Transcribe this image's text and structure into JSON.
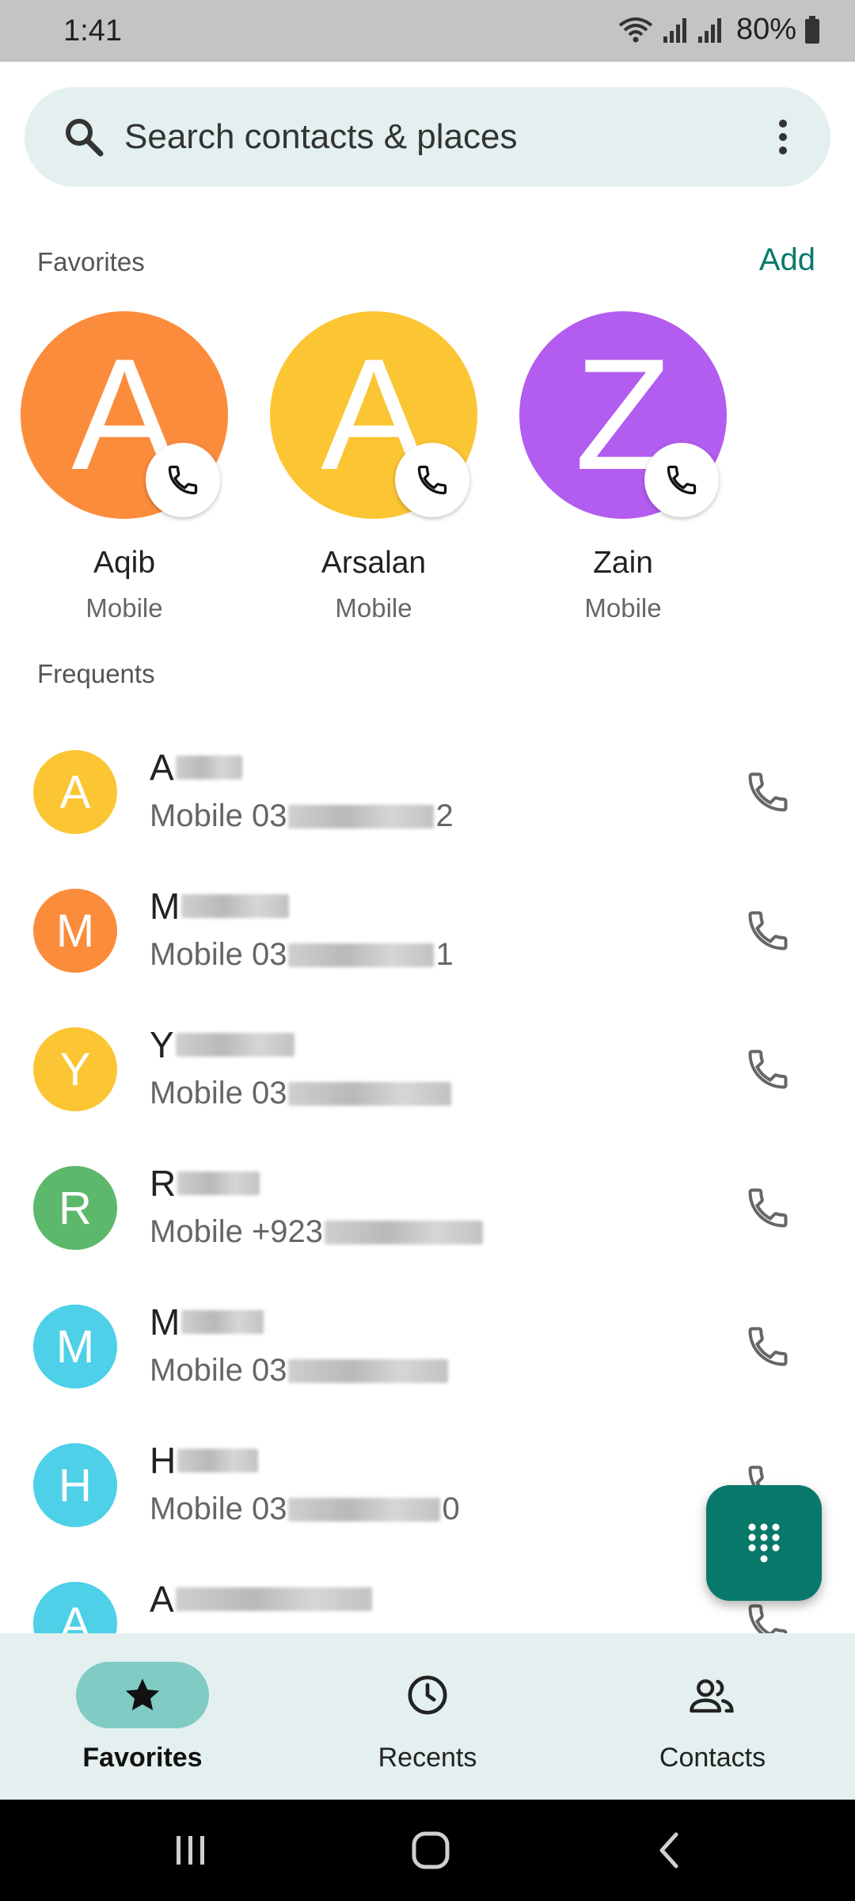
{
  "status_bar": {
    "time": "1:41",
    "battery": "80%"
  },
  "search": {
    "placeholder": "Search contacts & places"
  },
  "favorites": {
    "title": "Favorites",
    "add_label": "Add",
    "items": [
      {
        "initial": "A",
        "name": "Aqib",
        "type": "Mobile",
        "color": "#fb8c3c"
      },
      {
        "initial": "A",
        "name": "Arsalan",
        "type": "Mobile",
        "color": "#fbc534"
      },
      {
        "initial": "Z",
        "name": "Zain",
        "type": "Mobile",
        "color": "#b35cf0"
      }
    ]
  },
  "frequents": {
    "title": "Frequents",
    "items": [
      {
        "initial": "A",
        "color": "#fbc534",
        "name_visible": "A",
        "detail_prefix": "Mobile 03",
        "detail_suffix": "2"
      },
      {
        "initial": "M",
        "color": "#fb8c3c",
        "name_visible": "M",
        "detail_prefix": "Mobile 03",
        "detail_suffix": "1"
      },
      {
        "initial": "Y",
        "color": "#fbc534",
        "name_visible": "Y",
        "detail_prefix": "Mobile 03",
        "detail_suffix": ""
      },
      {
        "initial": "R",
        "color": "#5cb86a",
        "name_visible": "R",
        "detail_prefix": "Mobile +923",
        "detail_suffix": ""
      },
      {
        "initial": "M",
        "color": "#4dd0e8",
        "name_visible": "M",
        "detail_prefix": "Mobile 03",
        "detail_suffix": ""
      },
      {
        "initial": "H",
        "color": "#4dd0e8",
        "name_visible": "H",
        "detail_prefix": "Mobile 03",
        "detail_suffix": "0"
      },
      {
        "initial": "A",
        "color": "#4dd0e8",
        "name_visible": "A",
        "detail_prefix": "",
        "detail_suffix": ""
      }
    ]
  },
  "bottom_nav": {
    "items": [
      {
        "label": "Favorites",
        "icon": "star-icon",
        "active": true
      },
      {
        "label": "Recents",
        "icon": "clock-icon",
        "active": false
      },
      {
        "label": "Contacts",
        "icon": "people-icon",
        "active": false
      }
    ]
  },
  "colors": {
    "accent": "#0b7a6b",
    "fab": "#08786a",
    "search_bg": "#e3f0ef",
    "nav_active_pill": "#80cbc4"
  }
}
